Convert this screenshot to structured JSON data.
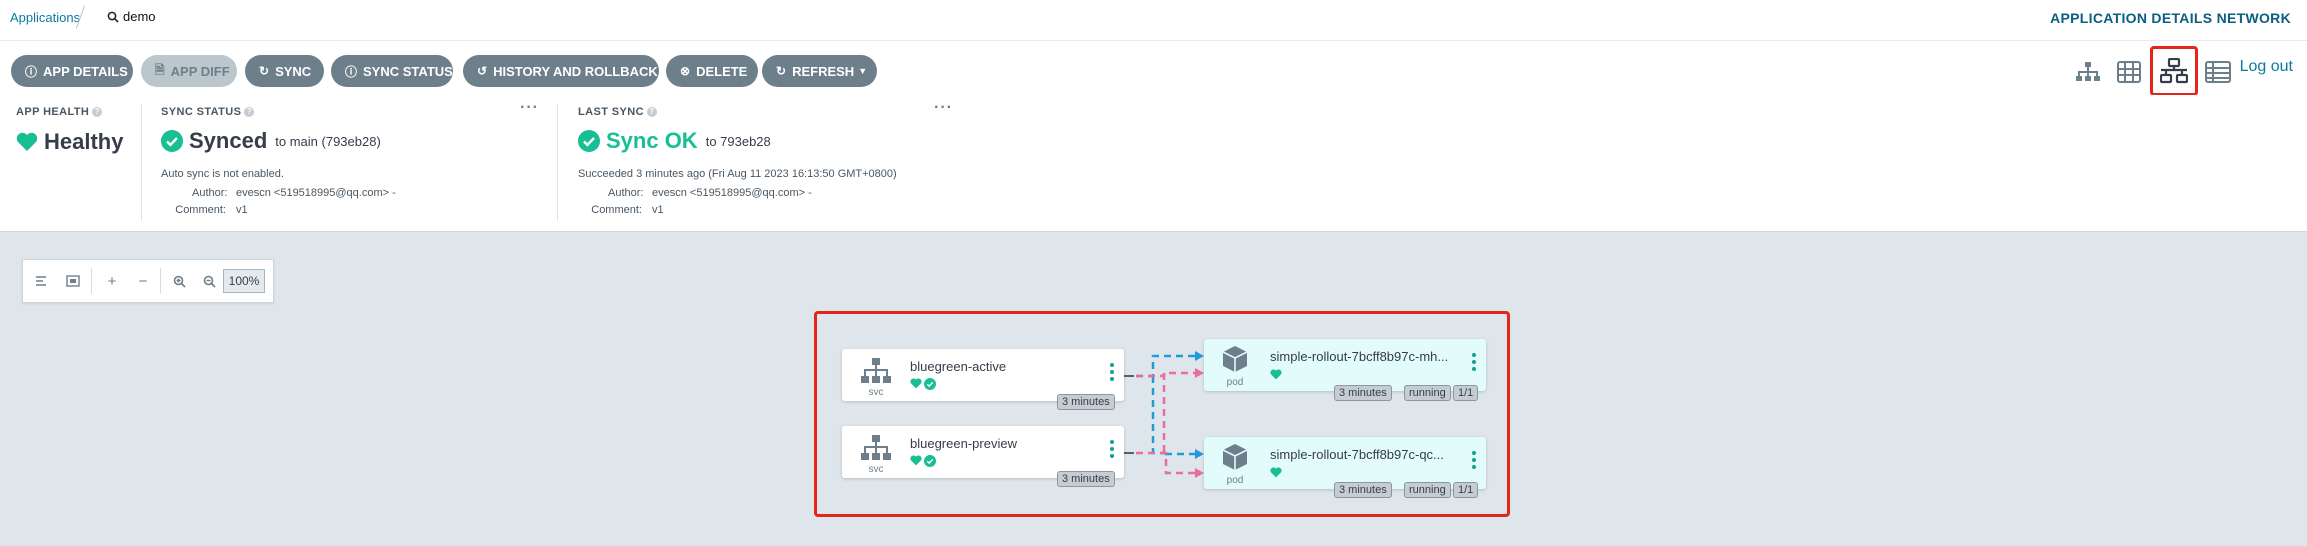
{
  "breadcrumb": {
    "root": "Applications",
    "search": "demo"
  },
  "title": "APPLICATION DETAILS NETWORK",
  "toolbar": {
    "buttons": [
      {
        "label": "APP DETAILS",
        "icon": "info-icon"
      },
      {
        "label": "APP DIFF",
        "icon": "file-icon"
      },
      {
        "label": "SYNC",
        "icon": "sync-icon"
      },
      {
        "label": "SYNC STATUS",
        "icon": "info-icon"
      },
      {
        "label": "HISTORY AND ROLLBACK",
        "icon": "history-icon"
      },
      {
        "label": "DELETE",
        "icon": "delete-icon"
      },
      {
        "label": "REFRESH",
        "icon": "refresh-icon"
      }
    ],
    "logout": "Log out"
  },
  "health": {
    "header": "APP HEALTH",
    "value": "Healthy"
  },
  "sync_status": {
    "header": "SYNC STATUS",
    "value": "Synced",
    "target": "to main (793eb28)",
    "auto_sync": "Auto sync is not enabled.",
    "author_label": "Author:",
    "author": "evescn <519518995@qq.com> -",
    "comment_label": "Comment:",
    "comment": "v1"
  },
  "last_sync": {
    "header": "LAST SYNC",
    "value": "Sync OK",
    "target": "to 793eb28",
    "succeeded": "Succeeded 3 minutes ago (Fri Aug 11 2023 16:13:50 GMT+0800)",
    "author_label": "Author:",
    "author": "evescn <519518995@qq.com> -",
    "comment_label": "Comment:",
    "comment": "v1"
  },
  "zoom": {
    "level": "100%"
  },
  "graph": {
    "services": [
      {
        "name": "bluegreen-active",
        "kind": "svc",
        "age": "3 minutes"
      },
      {
        "name": "bluegreen-preview",
        "kind": "svc",
        "age": "3 minutes"
      }
    ],
    "pods": [
      {
        "name": "simple-rollout-7bcff8b97c-mh...",
        "kind": "pod",
        "age": "3 minutes",
        "status": "running",
        "ready": "1/1"
      },
      {
        "name": "simple-rollout-7bcff8b97c-qc...",
        "kind": "pod",
        "age": "3 minutes",
        "status": "running",
        "ready": "1/1"
      }
    ]
  },
  "colors": {
    "healthy": "#18be94",
    "accent": "#0e7a9e",
    "highlight": "#e3251b",
    "active_link": "#1f9bd8",
    "preview_link": "#e96d9e"
  }
}
